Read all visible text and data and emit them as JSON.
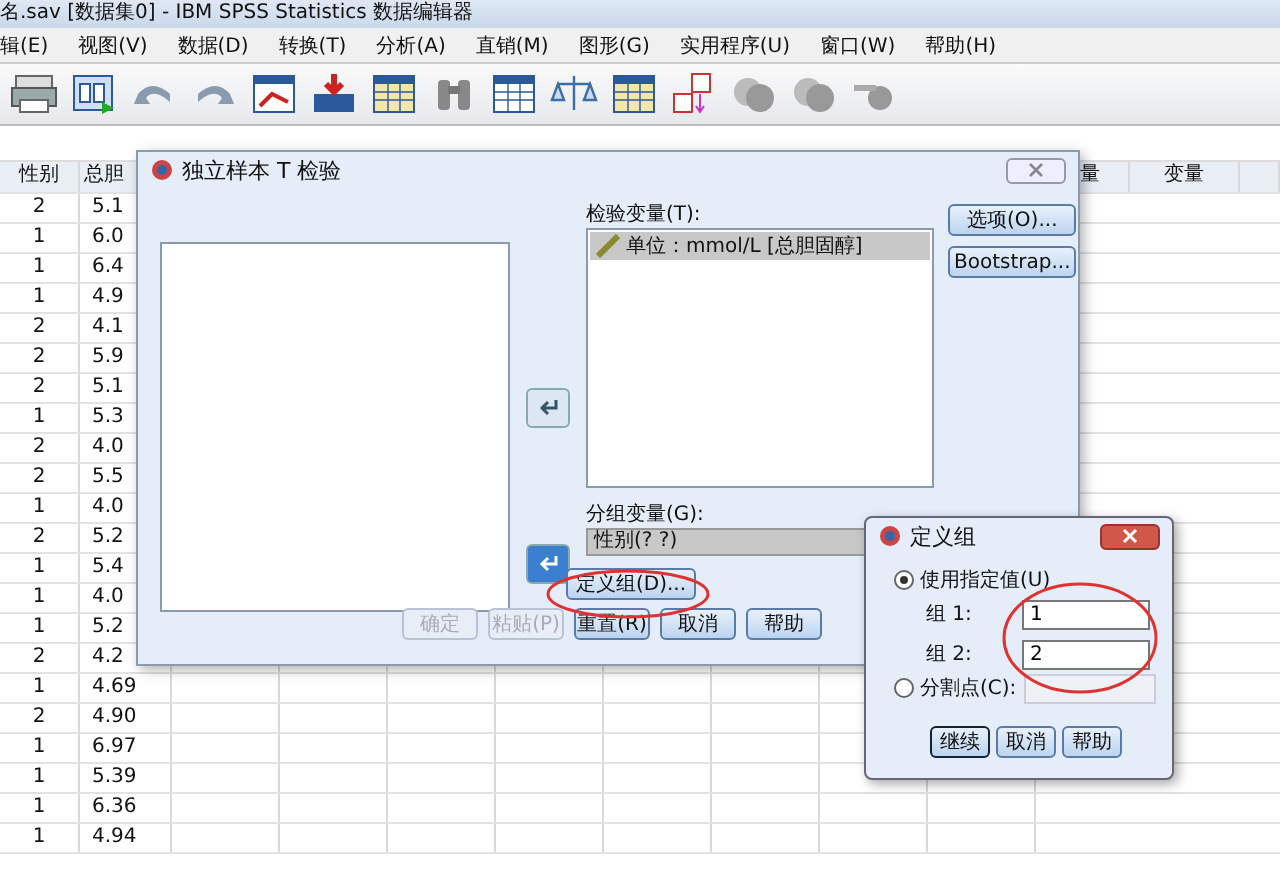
{
  "window": {
    "title": "名.sav [数据集0] - IBM SPSS Statistics 数据编辑器"
  },
  "menu": [
    "辑(E)",
    "视图(V)",
    "数据(D)",
    "转换(T)",
    "分析(A)",
    "直销(M)",
    "图形(G)",
    "实用程序(U)",
    "窗口(W)",
    "帮助(H)"
  ],
  "grid": {
    "columns": [
      "性别",
      "总胆"
    ],
    "right_columns": [
      "量",
      "变量"
    ],
    "rows": [
      [
        "2",
        "5.1"
      ],
      [
        "1",
        "6.0"
      ],
      [
        "1",
        "6.4"
      ],
      [
        "1",
        "4.9"
      ],
      [
        "2",
        "4.1"
      ],
      [
        "2",
        "5.9"
      ],
      [
        "2",
        "5.1"
      ],
      [
        "1",
        "5.3"
      ],
      [
        "2",
        "4.0"
      ],
      [
        "2",
        "5.5"
      ],
      [
        "1",
        "4.0"
      ],
      [
        "2",
        "5.2"
      ],
      [
        "1",
        "5.4"
      ],
      [
        "1",
        "4.0"
      ],
      [
        "1",
        "5.2"
      ],
      [
        "2",
        "4.2"
      ],
      [
        "1",
        "4.69"
      ],
      [
        "2",
        "4.90"
      ],
      [
        "1",
        "6.97"
      ],
      [
        "1",
        "5.39"
      ],
      [
        "1",
        "6.36"
      ],
      [
        "1",
        "4.94"
      ]
    ]
  },
  "ttest_dialog": {
    "title": "独立样本 T 检验",
    "test_var_label": "检验变量(T):",
    "test_vars": [
      {
        "label": "单位：mmol/L [总胆固醇]",
        "selected": true
      }
    ],
    "side_buttons": [
      "选项(O)...",
      "Bootstrap..."
    ],
    "group_label": "分组变量(G):",
    "group_var": "性别(? ?)",
    "define_button": "定义组(D)...",
    "buttons": [
      {
        "label": "确定",
        "disabled": true
      },
      {
        "label": "粘贴(P)",
        "disabled": true
      },
      {
        "label": "重置(R)",
        "disabled": false
      },
      {
        "label": "取消",
        "disabled": false
      },
      {
        "label": "帮助",
        "disabled": false
      }
    ]
  },
  "define_dialog": {
    "title": "定义组",
    "options": [
      {
        "label": "使用指定值(U)",
        "selected": true
      },
      {
        "label": "分割点(C):",
        "selected": false
      }
    ],
    "groups": [
      {
        "label": "组 1:",
        "value": "1"
      },
      {
        "label": "组 2:",
        "value": "2"
      }
    ],
    "buttons": [
      {
        "label": "继续",
        "default": true
      },
      {
        "label": "取消",
        "default": false
      },
      {
        "label": "帮助",
        "default": false
      }
    ]
  }
}
